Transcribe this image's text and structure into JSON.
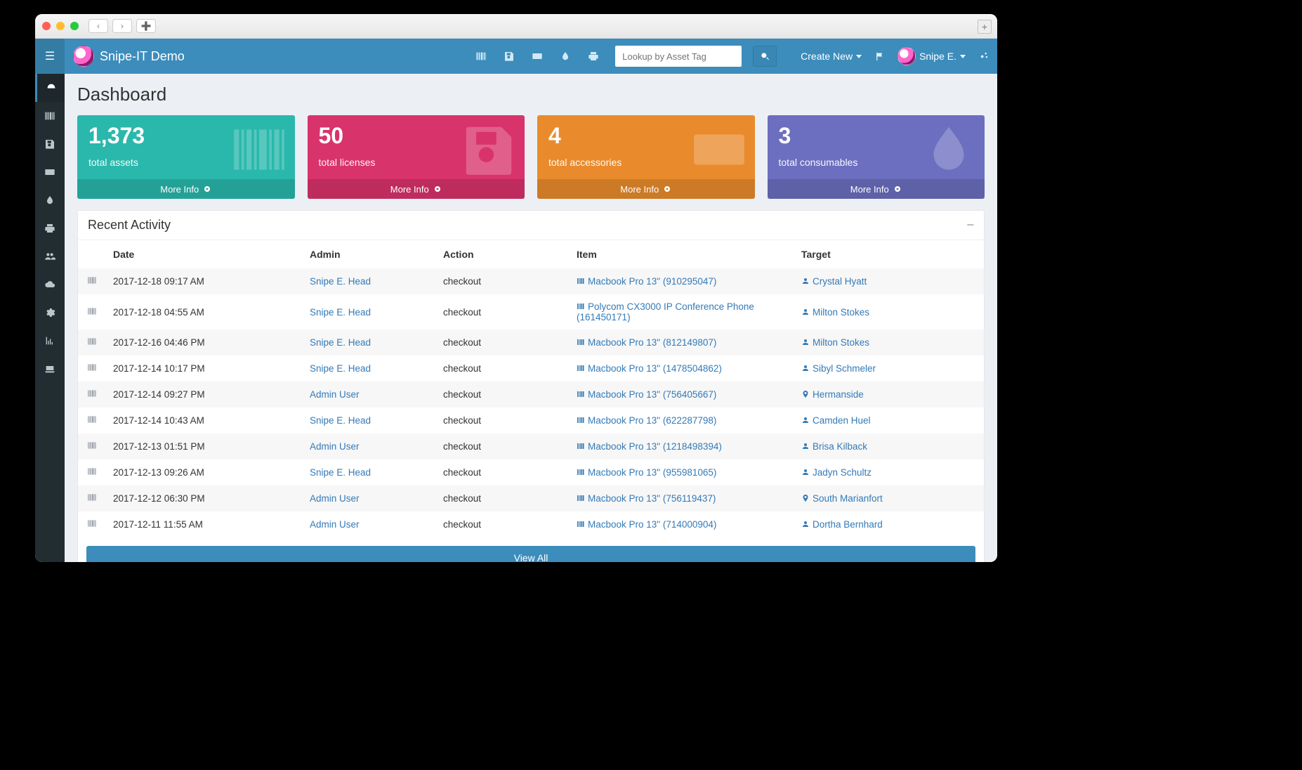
{
  "app": {
    "title": "Snipe-IT Demo"
  },
  "topbar": {
    "search_placeholder": "Lookup by Asset Tag",
    "create_new": "Create New",
    "user_name": "Snipe E."
  },
  "page": {
    "title": "Dashboard"
  },
  "cards": [
    {
      "value": "1,373",
      "label": "total assets",
      "more": "More Info",
      "color": "c-teal",
      "icon": "barcode"
    },
    {
      "value": "50",
      "label": "total licenses",
      "more": "More Info",
      "color": "c-pink",
      "icon": "save"
    },
    {
      "value": "4",
      "label": "total accessories",
      "more": "More Info",
      "color": "c-orange",
      "icon": "keyboard"
    },
    {
      "value": "3",
      "label": "total consumables",
      "more": "More Info",
      "color": "c-purple",
      "icon": "tint"
    }
  ],
  "recent": {
    "title": "Recent Activity",
    "columns": [
      "Date",
      "Admin",
      "Action",
      "Item",
      "Target"
    ],
    "view_all": "View All",
    "rows": [
      {
        "date": "2017-12-18 09:17 AM",
        "admin": "Snipe E. Head",
        "action": "checkout",
        "item": "Macbook Pro 13\" (910295047)",
        "target": "Crystal Hyatt",
        "target_icon": "user"
      },
      {
        "date": "2017-12-18 04:55 AM",
        "admin": "Snipe E. Head",
        "action": "checkout",
        "item": "Polycom CX3000 IP Conference Phone (161450171)",
        "target": "Milton Stokes",
        "target_icon": "user"
      },
      {
        "date": "2017-12-16 04:46 PM",
        "admin": "Snipe E. Head",
        "action": "checkout",
        "item": "Macbook Pro 13\" (812149807)",
        "target": "Milton Stokes",
        "target_icon": "user"
      },
      {
        "date": "2017-12-14 10:17 PM",
        "admin": "Snipe E. Head",
        "action": "checkout",
        "item": "Macbook Pro 13\" (1478504862)",
        "target": "Sibyl Schmeler",
        "target_icon": "user"
      },
      {
        "date": "2017-12-14 09:27 PM",
        "admin": "Admin User",
        "action": "checkout",
        "item": "Macbook Pro 13\" (756405667)",
        "target": "Hermanside",
        "target_icon": "location"
      },
      {
        "date": "2017-12-14 10:43 AM",
        "admin": "Snipe E. Head",
        "action": "checkout",
        "item": "Macbook Pro 13\" (622287798)",
        "target": "Camden Huel",
        "target_icon": "user"
      },
      {
        "date": "2017-12-13 01:51 PM",
        "admin": "Admin User",
        "action": "checkout",
        "item": "Macbook Pro 13\" (1218498394)",
        "target": "Brisa Kilback",
        "target_icon": "user"
      },
      {
        "date": "2017-12-13 09:26 AM",
        "admin": "Snipe E. Head",
        "action": "checkout",
        "item": "Macbook Pro 13\" (955981065)",
        "target": "Jadyn Schultz",
        "target_icon": "user"
      },
      {
        "date": "2017-12-12 06:30 PM",
        "admin": "Admin User",
        "action": "checkout",
        "item": "Macbook Pro 13\" (756119437)",
        "target": "South Marianfort",
        "target_icon": "location"
      },
      {
        "date": "2017-12-11 11:55 AM",
        "admin": "Admin User",
        "action": "checkout",
        "item": "Macbook Pro 13\" (714000904)",
        "target": "Dortha Bernhard",
        "target_icon": "user"
      }
    ]
  }
}
